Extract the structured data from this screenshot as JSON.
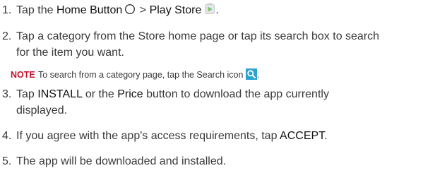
{
  "steps": [
    {
      "number": "1.",
      "before": "Tap the ",
      "home_button": "Home Button",
      "separator": " > ",
      "play_store": "Play Store",
      "after": "."
    },
    {
      "number": "2.",
      "line1": "Tap a category from the Store home page or tap its search box to search",
      "line2": "for the item you want."
    },
    {
      "number": "3.",
      "before": "Tap ",
      "install": "INSTALL",
      "middle": " or the ",
      "price": "Price",
      "after": " button to download the app currently",
      "line2": "displayed."
    },
    {
      "number": "4.",
      "before": "If you agree with the app's access requirements, tap ",
      "accept": "ACCEPT",
      "after": "."
    },
    {
      "number": "5.",
      "text": "The app will be downloaded and installed."
    }
  ],
  "note": {
    "label": "NOTE",
    "text": "To search from a category page, tap the Search icon",
    "after": "."
  },
  "colors": {
    "note_label": "#c8102e",
    "search_icon": "#2aa3cf",
    "body_text": "#3a3a3a"
  },
  "icons": {
    "home": "circle-outline-home-icon",
    "store": "play-store-icon",
    "search": "search-icon"
  }
}
